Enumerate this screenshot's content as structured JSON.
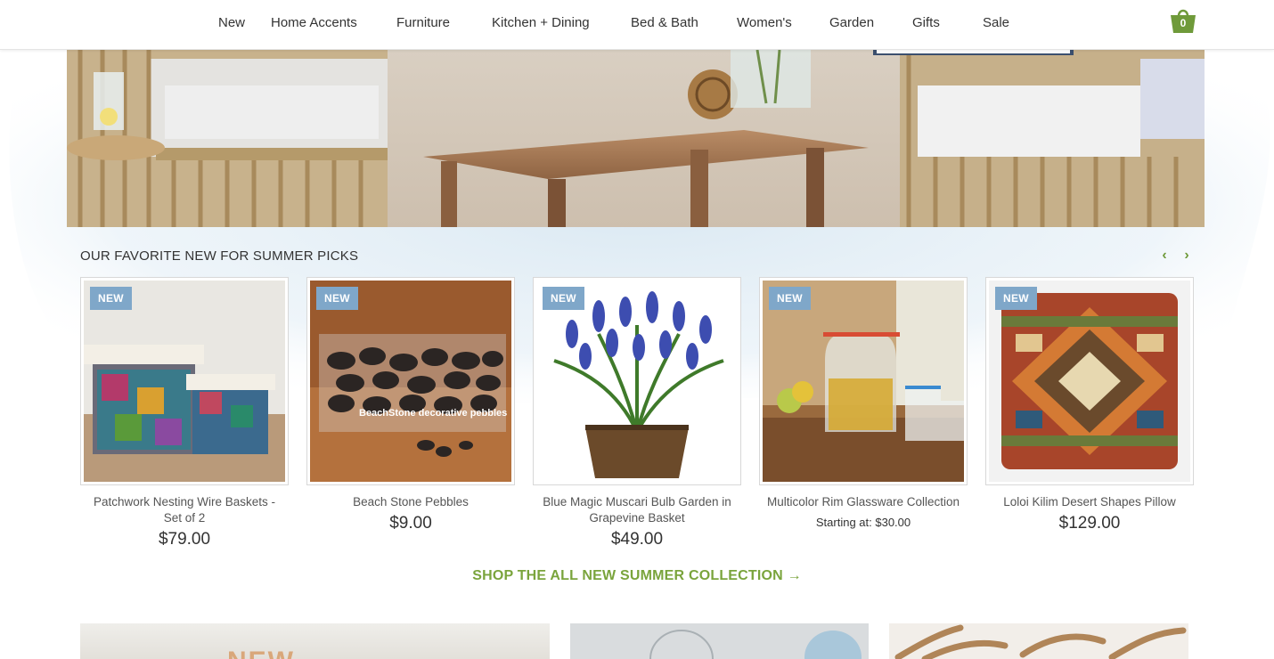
{
  "nav": {
    "items": [
      "New",
      "Home Accents",
      "Furniture",
      "Kitchen + Dining",
      "Bed & Bath",
      "Women's",
      "Garden",
      "Gifts",
      "Sale"
    ],
    "cart_count": "0"
  },
  "section": {
    "title": "OUR FAVORITE NEW FOR SUMMER PICKS",
    "prev_icon": "chevron-left-icon",
    "next_icon": "chevron-right-icon"
  },
  "products": [
    {
      "badge": "NEW",
      "name": "Patchwork Nesting Wire Baskets - Set of 2",
      "price": "$79.00"
    },
    {
      "badge": "NEW",
      "name": "Beach Stone Pebbles",
      "price": "$9.00"
    },
    {
      "badge": "NEW",
      "name": "Blue Magic Muscari Bulb Garden in Grapevine Basket",
      "price": "$49.00"
    },
    {
      "badge": "NEW",
      "name": "Multicolor Rim Glassware Collection",
      "price": "Starting at: $30.00"
    },
    {
      "badge": "NEW",
      "name": "Loloi Kilim Desert Shapes Pillow",
      "price": "$129.00"
    }
  ],
  "pebble_label": "BeachStone decorative pebbles",
  "shop_link": "SHOP THE ALL NEW SUMMER COLLECTION →",
  "promo_tile_text": "NEW",
  "colors": {
    "accent_green": "#7aa43c",
    "badge_blue": "#7fa7c9"
  }
}
